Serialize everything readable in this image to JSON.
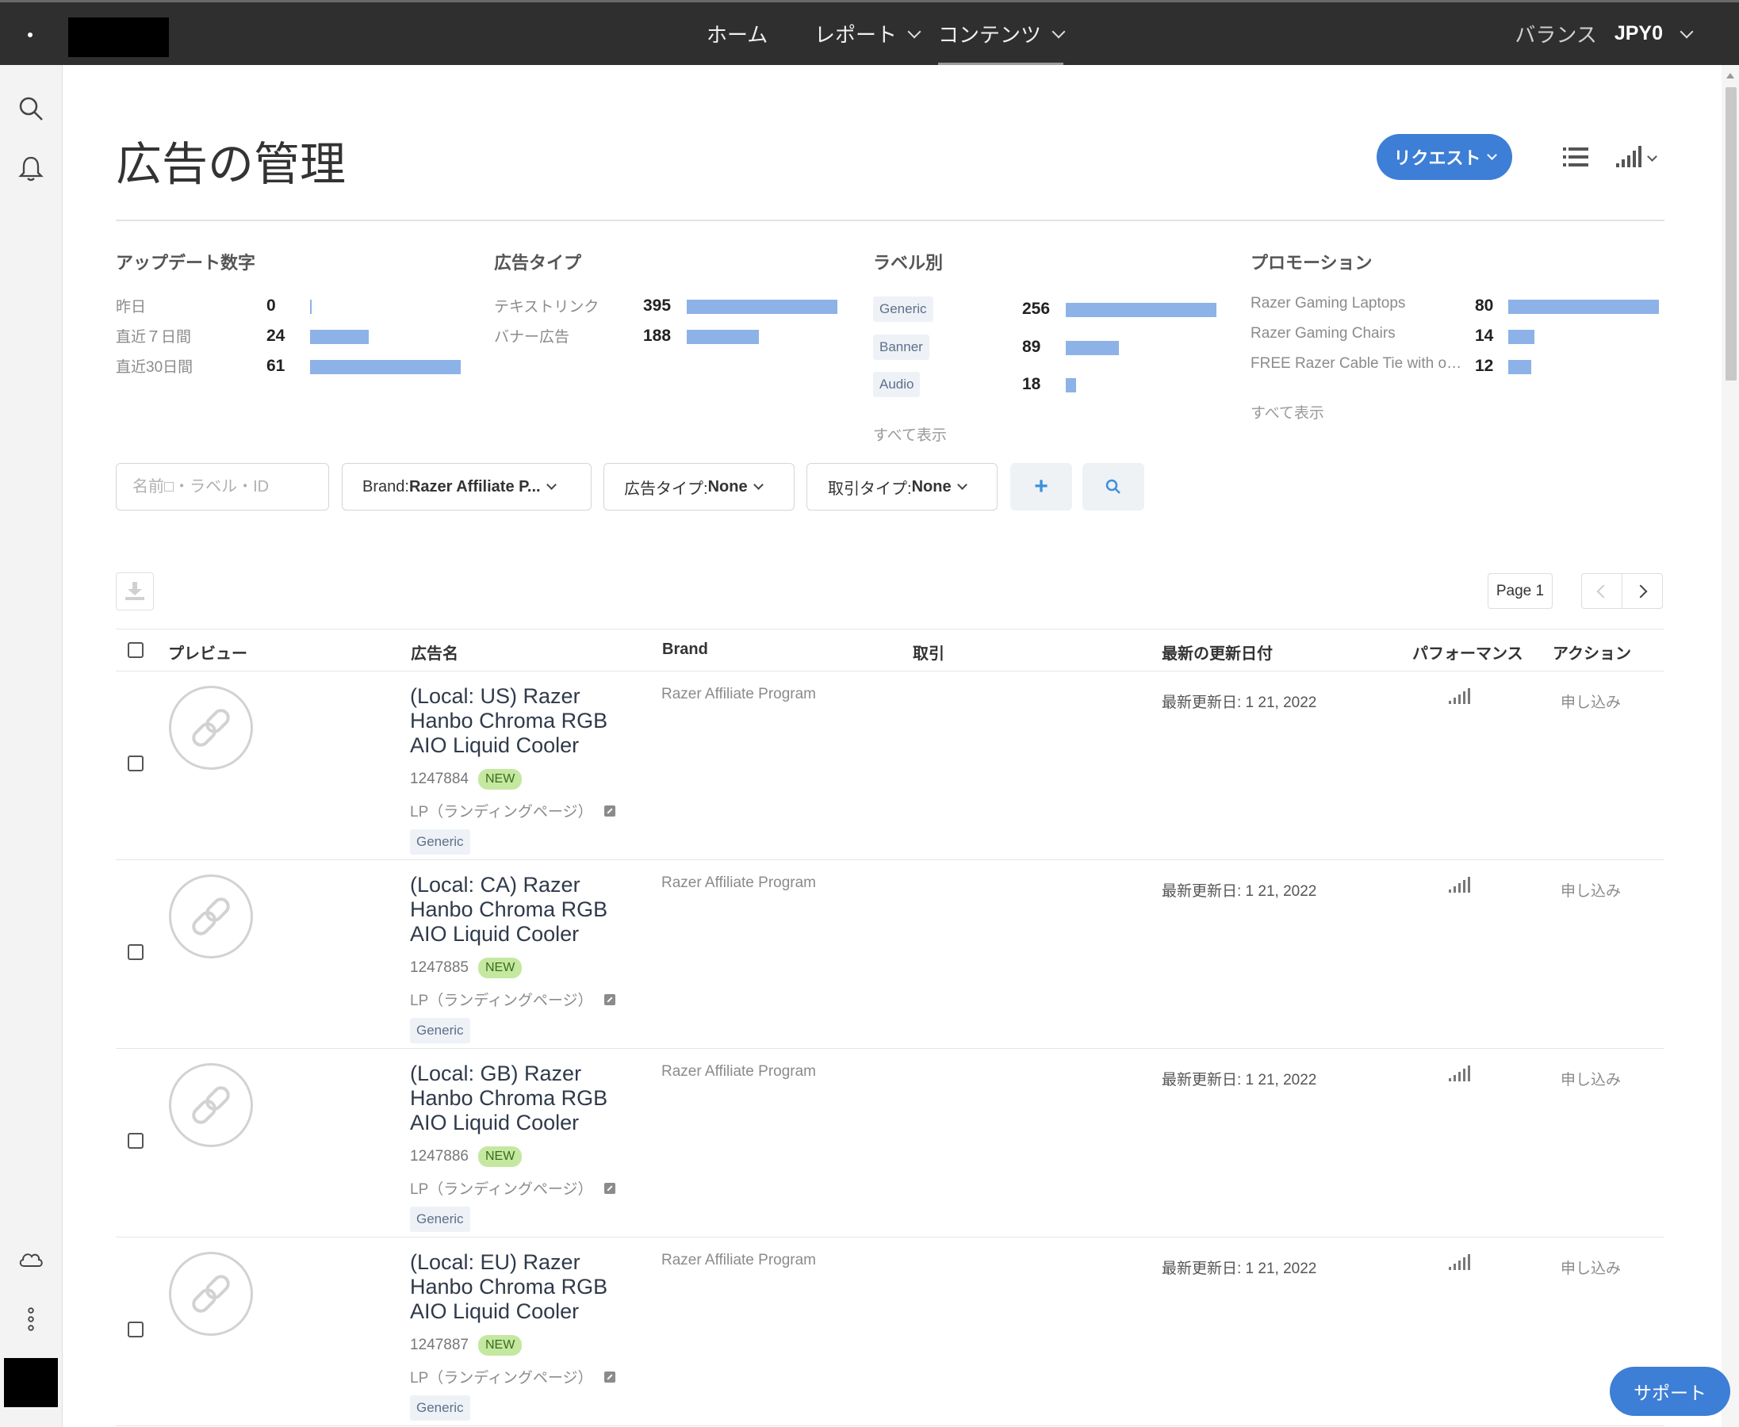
{
  "nav": {
    "home": "ホーム",
    "reports": "レポート",
    "contents": "コンテンツ",
    "balance_label": "バランス",
    "balance_value": "JPY0"
  },
  "header": {
    "title": "広告の管理",
    "request_button": "リクエスト"
  },
  "stats": {
    "updates": {
      "title": "アップデート数字",
      "rows": [
        {
          "label": "昨日",
          "value": "0",
          "ratio": 0
        },
        {
          "label": "直近７日間",
          "value": "24",
          "ratio": 0.39
        },
        {
          "label": "直近30日間",
          "value": "61",
          "ratio": 1
        }
      ]
    },
    "ad_type": {
      "title": "広告タイプ",
      "rows": [
        {
          "label": "テキストリンク",
          "value": "395",
          "ratio": 1
        },
        {
          "label": "バナー広告",
          "value": "188",
          "ratio": 0.48
        }
      ]
    },
    "labels": {
      "title": "ラベル別",
      "rows": [
        {
          "label": "Generic",
          "value": "256",
          "ratio": 1
        },
        {
          "label": "Banner",
          "value": "89",
          "ratio": 0.35
        },
        {
          "label": "Audio",
          "value": "18",
          "ratio": 0.07
        }
      ],
      "show_all": "すべて表示"
    },
    "promotion": {
      "title": "プロモーション",
      "rows": [
        {
          "label": "Razer Gaming Laptops",
          "value": "80",
          "ratio": 1
        },
        {
          "label": "Razer Gaming Chairs",
          "value": "14",
          "ratio": 0.175
        },
        {
          "label": "FREE Razer Cable Tie with ord...",
          "value": "12",
          "ratio": 0.15
        }
      ],
      "show_all": "すべて表示"
    }
  },
  "filters": {
    "search_placeholder": "名前□・ラベル・ID",
    "brand_label": "Brand: ",
    "brand_value": "Razer Affiliate P...",
    "adtype_label": "広告タイプ: ",
    "adtype_value": "None",
    "deal_label": "取引タイプ: ",
    "deal_value": "None"
  },
  "pagination": {
    "page": "Page 1"
  },
  "table": {
    "headers": {
      "preview": "プレビュー",
      "name": "広告名",
      "brand": "Brand",
      "deal": "取引",
      "updated": "最新の更新日付",
      "performance": "パフォーマンス",
      "action": "アクション"
    },
    "rows": [
      {
        "name": "(Local: US) Razer Hanbo Chroma RGB AIO Liquid Cooler",
        "id": "1247884",
        "badge": "NEW",
        "lp": "LP（ランディングページ）",
        "tag": "Generic",
        "brand": "Razer Affiliate Program",
        "deal": "",
        "updated": "最新更新日: 1 21, 2022",
        "action": "申し込み"
      },
      {
        "name": "(Local: CA) Razer Hanbo Chroma RGB AIO Liquid Cooler",
        "id": "1247885",
        "badge": "NEW",
        "lp": "LP（ランディングページ）",
        "tag": "Generic",
        "brand": "Razer Affiliate Program",
        "deal": "",
        "updated": "最新更新日: 1 21, 2022",
        "action": "申し込み"
      },
      {
        "name": "(Local: GB) Razer Hanbo Chroma RGB AIO Liquid Cooler",
        "id": "1247886",
        "badge": "NEW",
        "lp": "LP（ランディングページ）",
        "tag": "Generic",
        "brand": "Razer Affiliate Program",
        "deal": "",
        "updated": "最新更新日: 1 21, 2022",
        "action": "申し込み"
      },
      {
        "name": "(Local: EU) Razer Hanbo Chroma RGB AIO Liquid Cooler",
        "id": "1247887",
        "badge": "NEW",
        "lp": "LP（ランディングページ）",
        "tag": "Generic",
        "brand": "Razer Affiliate Program",
        "deal": "",
        "updated": "最新更新日: 1 21, 2022",
        "action": "申し込み"
      }
    ]
  },
  "support_button": "サポート",
  "colors": {
    "accent": "#3d7ed6",
    "bar": "#8cb2e8",
    "topbar": "#2f2f2f",
    "badge": "#c5e8a0"
  }
}
